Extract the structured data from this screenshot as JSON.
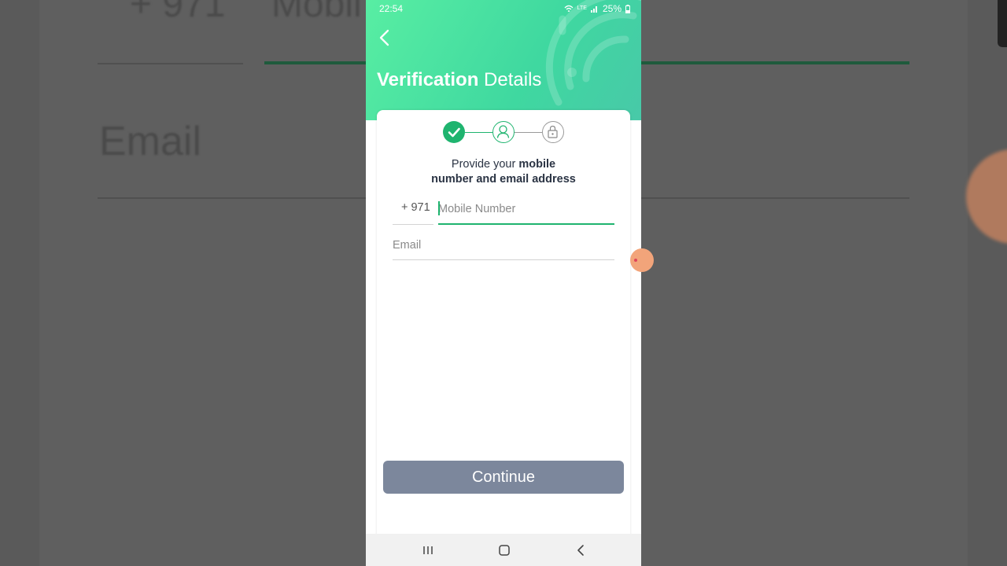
{
  "backdrop": {
    "prefix_text": "+ 971",
    "mobile_text": "Mobil",
    "email_text": "Email"
  },
  "status_bar": {
    "time": "22:54",
    "network_label": "LTE",
    "battery": "25%"
  },
  "header": {
    "title_bold": "Verification",
    "title_regular": " Details"
  },
  "stepper": {
    "steps": [
      {
        "icon": "check-icon",
        "state": "done"
      },
      {
        "icon": "user-icon",
        "state": "active"
      },
      {
        "icon": "lock-icon",
        "state": "pending"
      }
    ]
  },
  "form": {
    "instruction_pre": "Provide your ",
    "instruction_bold_1": "mobile",
    "instruction_bold_2": "number and email address",
    "country_code": "+ 971",
    "mobile_placeholder": "Mobile Number",
    "mobile_value": "",
    "email_placeholder": "Email",
    "email_value": "",
    "continue_label": "Continue"
  },
  "colors": {
    "accent": "#1fb46f",
    "header_gradient_start": "#58eea3",
    "header_gradient_end": "#48c9a8",
    "button_disabled": "#7c879c"
  },
  "nav_bar": {
    "icons": [
      "recent-apps-icon",
      "home-icon",
      "back-icon"
    ]
  }
}
